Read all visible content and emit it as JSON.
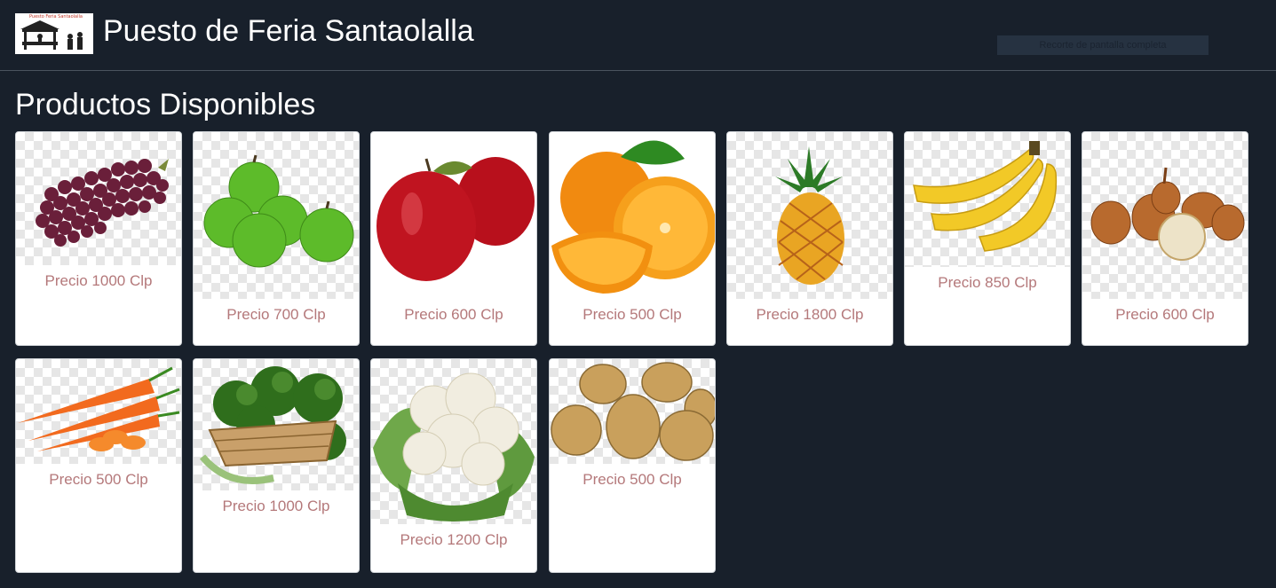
{
  "header": {
    "logo_text": "Puesto Feria Santaolalla",
    "title": "Puesto de Feria Santaolalla",
    "tooltip": "Recorte de pantalla completa"
  },
  "section_title": "Productos Disponibles",
  "products": [
    {
      "name": "grapes-icon",
      "price": "Precio 1000 Clp"
    },
    {
      "name": "green-apples-icon",
      "price": "Precio 700 Clp"
    },
    {
      "name": "red-apples-icon",
      "price": "Precio 600 Clp"
    },
    {
      "name": "oranges-icon",
      "price": "Precio 500 Clp"
    },
    {
      "name": "pineapple-icon",
      "price": "Precio 1800 Clp"
    },
    {
      "name": "bananas-icon",
      "price": "Precio 850 Clp"
    },
    {
      "name": "onions-icon",
      "price": "Precio 600 Clp"
    },
    {
      "name": "carrots-icon",
      "price": "Precio 500 Clp"
    },
    {
      "name": "broccoli-icon",
      "price": "Precio 1000 Clp"
    },
    {
      "name": "cauliflower-icon",
      "price": "Precio 1200 Clp"
    },
    {
      "name": "potatoes-icon",
      "price": "Precio 500 Clp"
    }
  ]
}
